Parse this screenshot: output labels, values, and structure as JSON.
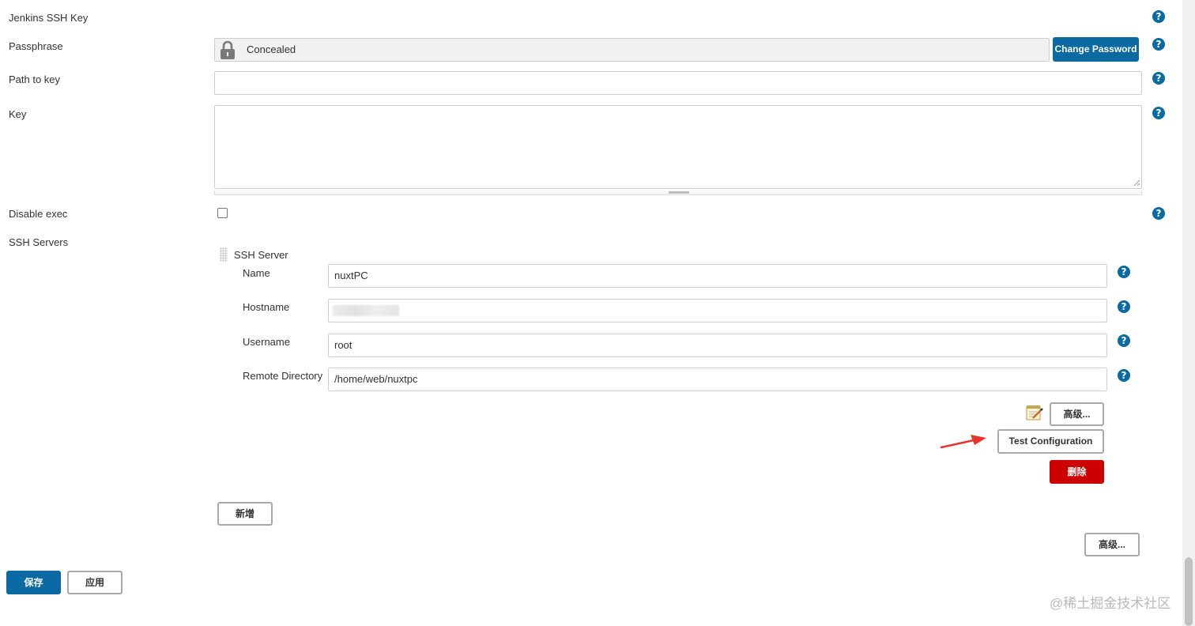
{
  "fields": {
    "jenkins_ssh_key": "Jenkins SSH Key",
    "passphrase": {
      "label": "Passphrase",
      "value": "Concealed",
      "change_button": "Change Password"
    },
    "path_to_key": {
      "label": "Path to key",
      "value": ""
    },
    "key": {
      "label": "Key",
      "value": ""
    },
    "disable_exec": {
      "label": "Disable exec",
      "checked": false
    },
    "ssh_servers": {
      "label": "SSH Servers"
    }
  },
  "ssh_server": {
    "title": "SSH Server",
    "name": {
      "label": "Name",
      "value": "nuxtPC"
    },
    "hostname": {
      "label": "Hostname",
      "value": ""
    },
    "username": {
      "label": "Username",
      "value": "root"
    },
    "remote_directory": {
      "label": "Remote Directory",
      "value": "/home/web/nuxtpc"
    },
    "advanced_button": "高级...",
    "test_button": "Test Configuration",
    "delete_button": "删除"
  },
  "add_button": "新增",
  "advanced_button": "高级...",
  "footer": {
    "save": "保存",
    "apply": "应用"
  },
  "watermark": "@稀土掘金技术社区",
  "colors": {
    "primary": "#0b6aa2",
    "danger": "#cc0000",
    "arrow": "#e8342a"
  },
  "icons": {
    "help": "question-circle-icon",
    "lock": "lock-icon",
    "notepad": "notepad-icon",
    "drag": "drag-handle-icon"
  }
}
